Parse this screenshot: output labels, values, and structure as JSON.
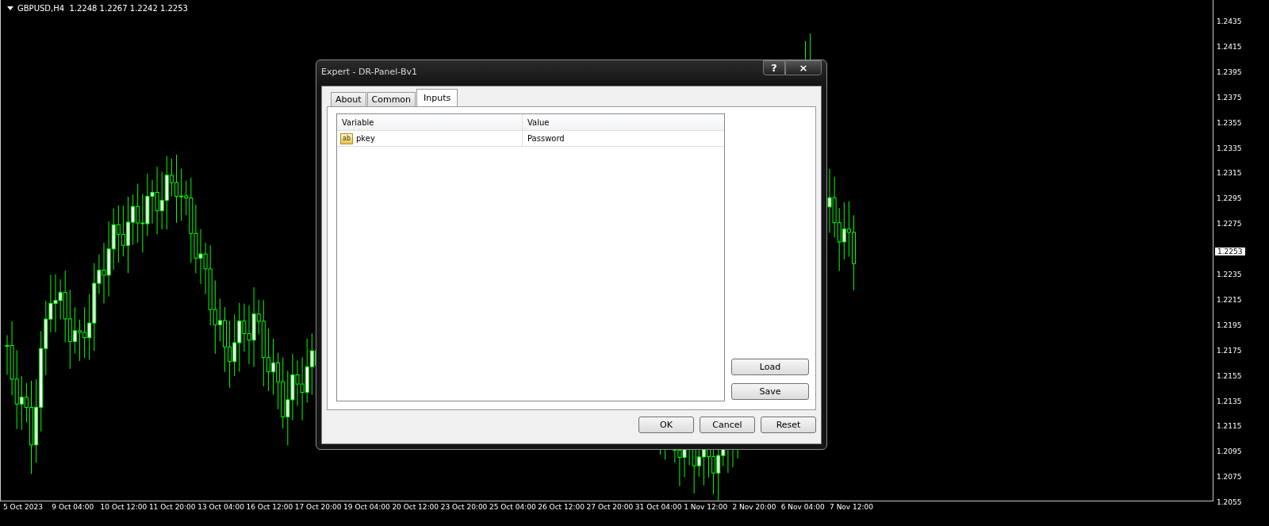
{
  "chart": {
    "header": "GBPUSD,H4  1.2248 1.2267 1.2242 1.2253",
    "price_axis": [
      "1.2435",
      "1.2415",
      "1.2395",
      "1.2375",
      "1.2355",
      "1.2335",
      "1.2315",
      "1.2295",
      "1.2275",
      "1.2235",
      "1.2215",
      "1.2195",
      "1.2175",
      "1.2155",
      "1.2135",
      "1.2115",
      "1.2095",
      "1.2075",
      "1.2055"
    ],
    "current_price": "1.2253",
    "time_axis": [
      "5 Oct 2023",
      "9 Oct 04:00",
      "10 Oct 12:00",
      "11 Oct 20:00",
      "13 Oct 04:00",
      "16 Oct 12:00",
      "17 Oct 20:00",
      "19 Oct 04:00",
      "20 Oct 12:00",
      "23 Oct 20:00",
      "25 Oct 04:00",
      "26 Oct 12:00",
      "27 Oct 20:00",
      "31 Oct 04:00",
      "1 Nov 12:00",
      "2 Nov 20:00",
      "6 Nov 04:00",
      "7 Nov 12:00"
    ]
  },
  "dialog": {
    "title": "Expert - DR-Panel-Bv1",
    "title_buttons": [
      "?",
      "×"
    ],
    "tabs": [
      {
        "label": "About",
        "selected": false
      },
      {
        "label": "Common",
        "selected": false
      },
      {
        "label": "Inputs",
        "selected": true
      }
    ],
    "table": {
      "columns": [
        "Variable",
        "Value"
      ],
      "rows": [
        {
          "type_badge": "ab",
          "variable": "pkey",
          "value": "Password"
        }
      ]
    },
    "side_buttons": [
      "Load",
      "Save"
    ],
    "buttons": [
      "OK",
      "Cancel",
      "Reset"
    ]
  }
}
